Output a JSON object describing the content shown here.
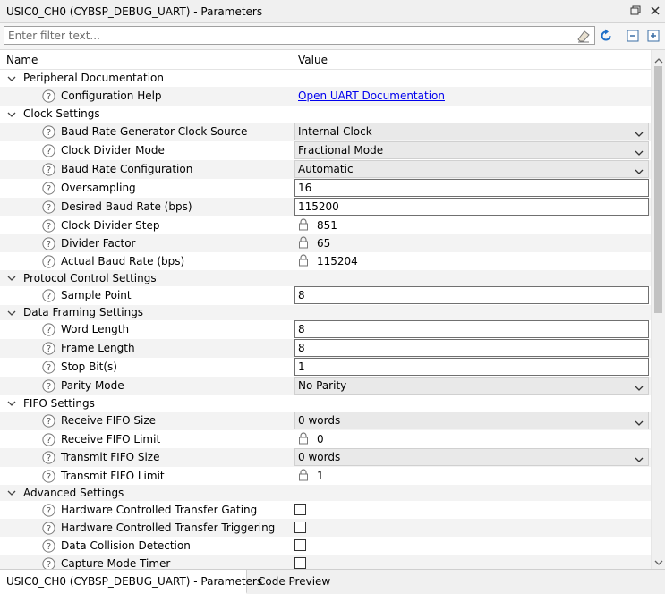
{
  "window": {
    "title": "USIC0_CH0 (CYBSP_DEBUG_UART) - Parameters"
  },
  "filter": {
    "placeholder": "Enter filter text..."
  },
  "columns": {
    "name": "Name",
    "value": "Value"
  },
  "tabs": [
    {
      "label": "USIC0_CH0 (CYBSP_DEBUG_UART) - Parameters",
      "active": true
    },
    {
      "label": "Code Preview",
      "active": false
    }
  ],
  "rows": [
    {
      "kind": "category",
      "label": "Peripheral Documentation"
    },
    {
      "kind": "param",
      "label": "Configuration Help",
      "type": "link",
      "value": "Open UART Documentation"
    },
    {
      "kind": "category",
      "label": "Clock Settings"
    },
    {
      "kind": "param",
      "label": "Baud Rate Generator Clock Source",
      "type": "select",
      "value": "Internal Clock"
    },
    {
      "kind": "param",
      "label": "Clock Divider Mode",
      "type": "select",
      "value": "Fractional Mode"
    },
    {
      "kind": "param",
      "label": "Baud Rate Configuration",
      "type": "select",
      "value": "Automatic"
    },
    {
      "kind": "param",
      "label": "Oversampling",
      "type": "input",
      "value": "16"
    },
    {
      "kind": "param",
      "label": "Desired Baud Rate (bps)",
      "type": "input",
      "value": "115200"
    },
    {
      "kind": "param",
      "label": "Clock Divider Step",
      "type": "locked",
      "value": "851"
    },
    {
      "kind": "param",
      "label": "Divider Factor",
      "type": "locked",
      "value": "65"
    },
    {
      "kind": "param",
      "label": "Actual Baud Rate (bps)",
      "type": "locked",
      "value": "115204"
    },
    {
      "kind": "category",
      "label": "Protocol Control Settings"
    },
    {
      "kind": "param",
      "label": "Sample Point",
      "type": "input",
      "value": "8"
    },
    {
      "kind": "category",
      "label": "Data Framing Settings"
    },
    {
      "kind": "param",
      "label": "Word Length",
      "type": "input",
      "value": "8"
    },
    {
      "kind": "param",
      "label": "Frame Length",
      "type": "input",
      "value": "8"
    },
    {
      "kind": "param",
      "label": "Stop Bit(s)",
      "type": "input",
      "value": "1"
    },
    {
      "kind": "param",
      "label": "Parity Mode",
      "type": "select",
      "value": "No Parity"
    },
    {
      "kind": "category",
      "label": "FIFO Settings"
    },
    {
      "kind": "param",
      "label": "Receive FIFO Size",
      "type": "select",
      "value": "0 words"
    },
    {
      "kind": "param",
      "label": "Receive FIFO Limit",
      "type": "locked",
      "value": "0"
    },
    {
      "kind": "param",
      "label": "Transmit FIFO Size",
      "type": "select",
      "value": "0 words"
    },
    {
      "kind": "param",
      "label": "Transmit FIFO Limit",
      "type": "locked",
      "value": "1"
    },
    {
      "kind": "category",
      "label": "Advanced Settings"
    },
    {
      "kind": "param",
      "label": "Hardware Controlled Transfer Gating",
      "type": "checkbox",
      "value": false
    },
    {
      "kind": "param",
      "label": "Hardware Controlled Transfer Triggering",
      "type": "checkbox",
      "value": false
    },
    {
      "kind": "param",
      "label": "Data Collision Detection",
      "type": "checkbox",
      "value": false
    },
    {
      "kind": "param",
      "label": "Capture Mode Timer",
      "type": "checkbox",
      "value": false
    }
  ],
  "colors": {
    "link": "#0000ee",
    "select_bg": "#e9e9e9",
    "alt_row": "#f3f3f3",
    "refresh_icon": "#1e6fc8"
  }
}
